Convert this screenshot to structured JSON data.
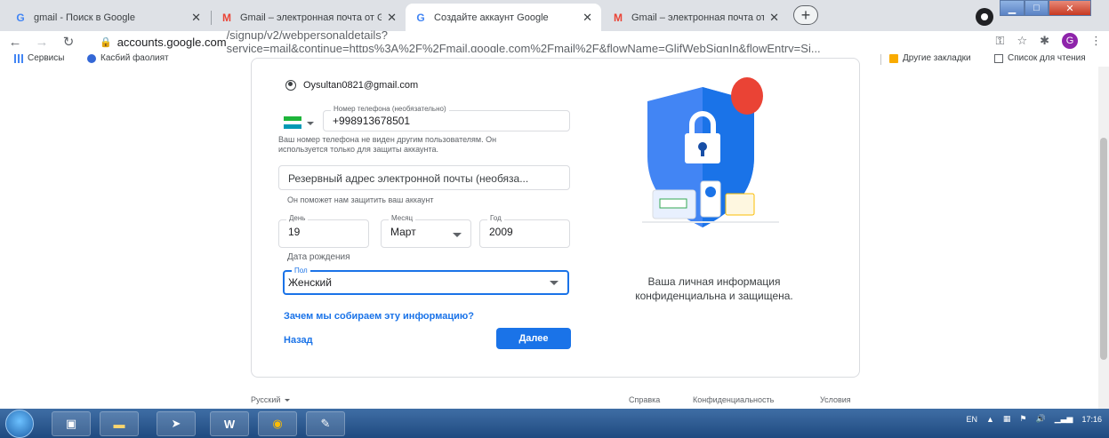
{
  "browser": {
    "tabs": [
      {
        "title": "gmail - Поиск в Google",
        "icon": "google-icon",
        "active": false
      },
      {
        "title": "Gmail – электронная почта от G",
        "icon": "gmail-icon",
        "active": false
      },
      {
        "title": "Создайте аккаунт Google",
        "icon": "google-icon",
        "active": true
      },
      {
        "title": "Gmail – электронная почта от G",
        "icon": "gmail-icon",
        "active": false
      }
    ],
    "url_host": "accounts.google.com",
    "url_rest": "/signup/v2/webpersonaldetails?service=mail&continue=https%3A%2F%2Fmail.google.com%2Fmail%2F&flowName=GlifWebSignIn&flowEntry=Si...",
    "profile_letter": "G",
    "bookmarks": {
      "apps": "Сервисы",
      "item1": "Касбий фаолият",
      "other": "Другие закладки",
      "reading_list": "Список для чтения"
    }
  },
  "form": {
    "email": "Oysultan0821@gmail.com",
    "phone": {
      "label": "Номер телефона (необязательно)",
      "value": "+998913678501"
    },
    "phone_helper_line1": "Ваш номер телефона не виден другим пользователям. Он",
    "phone_helper_line2": "используется только для защиты аккаунта.",
    "recovery_email": {
      "placeholder": "Резервный адрес электронной почты (необяза..."
    },
    "recovery_helper": "Он поможет нам защитить ваш аккаунт",
    "day": {
      "label": "День",
      "value": "19"
    },
    "month": {
      "label": "Месяц",
      "value": "Март"
    },
    "year": {
      "label": "Год",
      "value": "2009"
    },
    "birth_helper": "Дата рождения",
    "gender": {
      "label": "Пол",
      "value": "Женский"
    },
    "why_link": "Зачем мы собираем эту информацию?",
    "back": "Назад",
    "next": "Далее"
  },
  "illustration": {
    "caption_line1": "Ваша личная информация",
    "caption_line2": "конфиденциальна и защищена."
  },
  "footer": {
    "language": "Русский",
    "help": "Справка",
    "privacy": "Конфиденциальность",
    "terms": "Условия"
  },
  "taskbar": {
    "lang": "EN",
    "time": "17:16",
    "word_label": "W"
  },
  "colors": {
    "accent": "#1a73e8",
    "shield": "#4285f4",
    "balloon": "#ea4335"
  }
}
